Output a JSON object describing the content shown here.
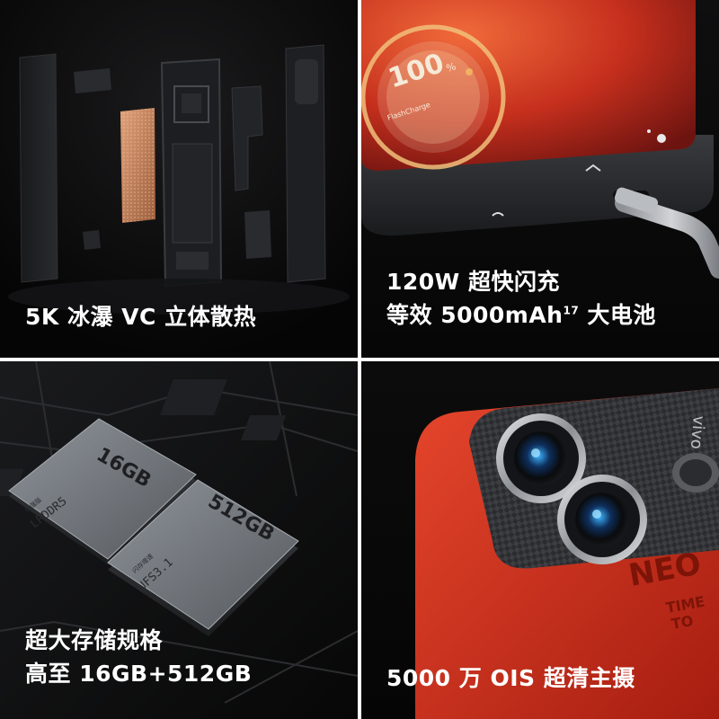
{
  "tiles": {
    "cooling": {
      "caption": "5K 冰瀑 VC 立体散热"
    },
    "charging": {
      "screen_percent": "100",
      "screen_percent_unit": "%",
      "screen_brand": "FlashCharge",
      "caption_line1": "120W 超快闪充",
      "caption_line2_main": "等效 5000mAh",
      "caption_line2_sup": "17",
      "caption_line2_tail": " 大电池"
    },
    "storage": {
      "chip1_capacity": "16GB",
      "chip1_label_small": "增强版",
      "chip1_type": "LPDDR5",
      "chip2_capacity": "512GB",
      "chip2_label_small": "闪存增速",
      "chip2_type": "UFS3.1",
      "caption_line1": "超大存储规格",
      "caption_line2": "高至 16GB+512GB"
    },
    "camera": {
      "brand_text": "vivo",
      "series_text": "NEO",
      "slogan_line1": "TIME",
      "slogan_line2": "TO",
      "caption": "5000 万 OIS  超清主摄"
    }
  },
  "colors": {
    "tile_bg": "#0a0a0a",
    "accent_red": "#d83420",
    "copper": "#c9875b",
    "chip_gray": "#70757b"
  }
}
